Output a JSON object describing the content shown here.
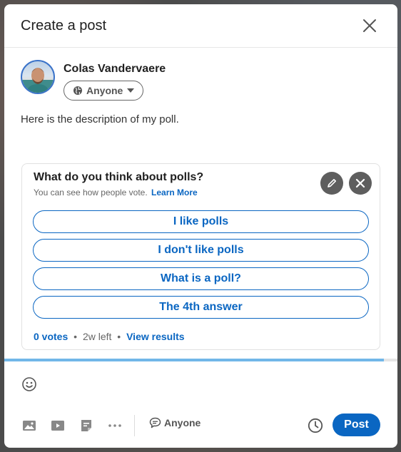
{
  "modal": {
    "title": "Create a post"
  },
  "author": {
    "name": "Colas Vandervaere",
    "visibility_label": "Anyone"
  },
  "post": {
    "description": "Here is the description of my poll."
  },
  "poll": {
    "question": "What do you think about polls?",
    "subtitle": "You can see how people vote.",
    "learn_more": "Learn More",
    "options": [
      {
        "label": "I like polls"
      },
      {
        "label": "I don't like polls"
      },
      {
        "label": "What is a poll?"
      },
      {
        "label": "The 4th answer"
      }
    ],
    "votes": "0 votes",
    "time_left": "2w left",
    "view_results": "View results"
  },
  "progress": {
    "fraction": 0.965
  },
  "toolbar": {
    "comment_control_label": "Anyone",
    "post_label": "Post"
  },
  "colors": {
    "accent": "#0a66c2",
    "progress": "#71b7e8",
    "icon_dark": "#5e5e5e"
  },
  "icons": [
    "close-icon",
    "globe-icon",
    "caret-down-icon",
    "pencil-icon",
    "x-icon",
    "smiley-icon",
    "photo-icon",
    "video-icon",
    "document-icon",
    "more-icon",
    "comment-icon",
    "clock-icon"
  ]
}
